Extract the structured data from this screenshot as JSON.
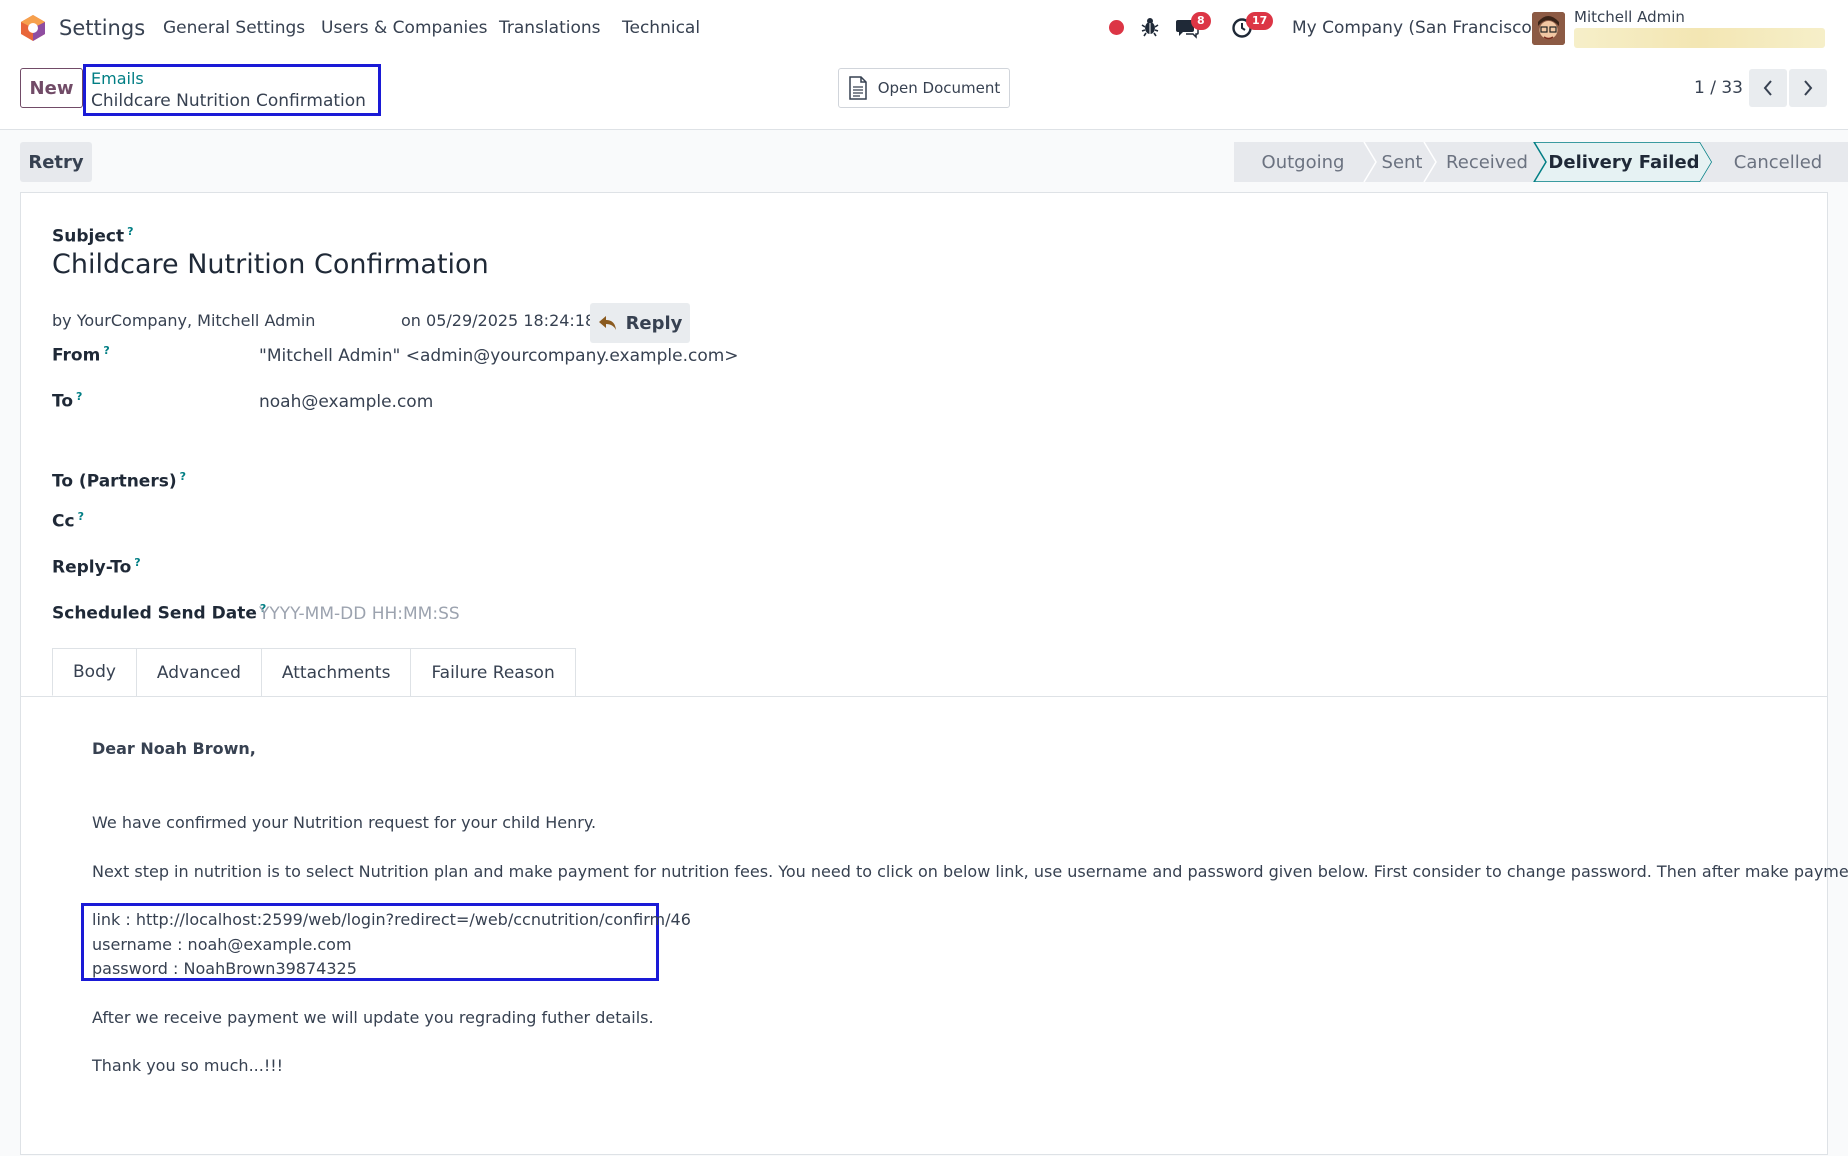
{
  "navbar": {
    "app_name": "Settings",
    "menu": [
      "General Settings",
      "Users & Companies",
      "Translations",
      "Technical"
    ],
    "messages_count": "8",
    "activities_count": "17",
    "company": "My Company (San Francisco)",
    "user_name": "Mitchell Admin"
  },
  "control": {
    "new_label": "New",
    "breadcrumb_parent": "Emails",
    "breadcrumb_current": "Childcare Nutrition Confirmation",
    "open_document_label": "Open Document",
    "pager": "1 / 33"
  },
  "status": {
    "retry_label": "Retry",
    "stages": [
      "Outgoing",
      "Sent",
      "Received",
      "Delivery Failed",
      "Cancelled"
    ],
    "active_stage": "Delivery Failed"
  },
  "form": {
    "subject_label": "Subject",
    "subject": "Childcare Nutrition Confirmation",
    "author": "by YourCompany, Mitchell Admin",
    "date": "on 05/29/2025 18:24:18",
    "reply_label": "Reply",
    "from_label": "From",
    "from_value": "\"Mitchell Admin\" <admin@yourcompany.example.com>",
    "to_label": "To",
    "to_value": "noah@example.com",
    "to_partners_label": "To (Partners)",
    "cc_label": "Cc",
    "reply_to_label": "Reply-To",
    "scheduled_label": "Scheduled Send Date",
    "scheduled_placeholder": "YYYY-MM-DD HH:MM:SS"
  },
  "tabs": [
    "Body",
    "Advanced",
    "Attachments",
    "Failure Reason"
  ],
  "body": {
    "greeting": "Dear Noah Brown,",
    "line1": "We have confirmed your Nutrition request for your child Henry.",
    "line2": "Next step in nutrition is to select Nutrition plan and make payment for nutrition fees. You need to click on below link, use username and password given below. First consider to change password. Then after make payment.",
    "link": "link : http://localhost:2599/web/login?redirect=/web/ccnutrition/confirm/46",
    "username": "username : noah@example.com",
    "password": "password : NoahBrown39874325",
    "line3": "After we receive payment we will update you regrading futher details.",
    "thanks": "Thank you so much...!!!"
  },
  "colors": {
    "brand": "#714b67",
    "link": "#017e84",
    "badge": "#dc3545",
    "highlight_box": "#1a1ad6"
  }
}
